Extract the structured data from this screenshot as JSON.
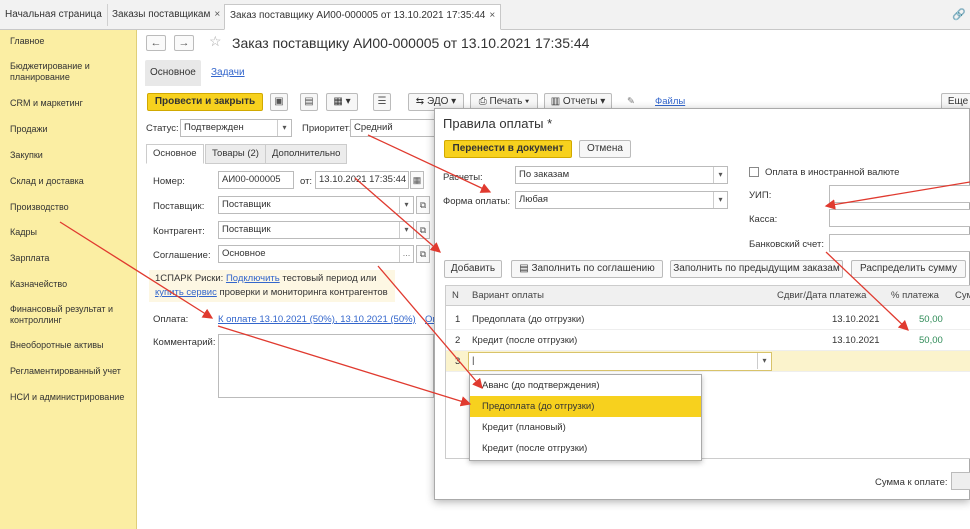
{
  "tabs": [
    {
      "label": "Начальная страница"
    },
    {
      "label": "Заказы поставщикам"
    },
    {
      "label": "Заказ поставщику АИ00-000005 от 13.10.2021 17:35:44"
    }
  ],
  "sidebar": {
    "items": [
      {
        "label": "Главное"
      },
      {
        "label": "Бюджетирование и планирование"
      },
      {
        "label": "CRM и маркетинг"
      },
      {
        "label": "Продажи"
      },
      {
        "label": "Закупки"
      },
      {
        "label": "Склад и доставка"
      },
      {
        "label": "Производство"
      },
      {
        "label": "Кадры"
      },
      {
        "label": "Зарплата"
      },
      {
        "label": "Казначейство"
      },
      {
        "label": "Финансовый результат и контроллинг"
      },
      {
        "label": "Внеоборотные активы"
      },
      {
        "label": "Регламентированный учет"
      },
      {
        "label": "НСИ и администрирование"
      }
    ]
  },
  "form": {
    "title": "Заказ поставщику АИ00-000005 от 13.10.2021 17:35:44",
    "subtab_main": "Основное",
    "subtab_tasks": "Задачи",
    "post_close_label": "Провести и закрыть",
    "edo_label": "ЭДО",
    "print_label": "Печать",
    "reports_label": "Отчеты",
    "files_label": "Файлы",
    "more_label": "Еще",
    "status_label": "Статус:",
    "status_value": "Подтвержден",
    "priority_label": "Приоритет:",
    "priority_value": "Средний",
    "inner_tabs": [
      "Основное",
      "Товары (2)",
      "Дополнительно"
    ],
    "number_label": "Номер:",
    "number_value": "АИ00-000005",
    "from_label": "от:",
    "date_value": "13.10.2021 17:35:44",
    "supplier_label": "Поставщик:",
    "supplier_value": "Поставщик",
    "counterparty_label": "Контрагент:",
    "counterparty_value": "Поставщик",
    "agreement_label": "Соглашение:",
    "agreement_value": "Основное",
    "notice_1": "1СПАРК Риски:",
    "notice_link1": "Подключить",
    "notice_2": "тестовый период или",
    "notice_link2": "купить сервис",
    "notice_3": "проверки и мониторинга контрагентов",
    "payment_label": "Оплата:",
    "payment_value": "К оплате 13.10.2021 (50%), 13.10.2021 (50%)",
    "payment_more": "Оп",
    "comment_label": "Комментарий:"
  },
  "dialog": {
    "title": "Правила оплаты *",
    "transfer_label": "Перенести в документ",
    "cancel_label": "Отмена",
    "settlements_label": "Расчеты:",
    "settlements_value": "По заказам",
    "payment_form_label": "Форма оплаты:",
    "payment_form_value": "Любая",
    "foreign_currency_label": "Оплата в иностранной валюте",
    "uip_label": "УИП:",
    "cashbox_label": "Касса:",
    "bank_account_label": "Банковский счет:",
    "add_label": "Добавить",
    "fill_agreement_label": "Заполнить по соглашению",
    "fill_prev_label": "Заполнить по предыдущим заказам",
    "distribute_label": "Распределить сумму",
    "columns": [
      "N",
      "Вариант оплаты",
      "Сдвиг/Дата платежа",
      "% платежа",
      "Сум"
    ],
    "rows": [
      {
        "n": "1",
        "variant": "Предоплата (до отгрузки)",
        "date": "13.10.2021",
        "percent": "50,00"
      },
      {
        "n": "2",
        "variant": "Кредит (после отгрузки)",
        "date": "13.10.2021",
        "percent": "50,00"
      },
      {
        "n": "3",
        "variant": "",
        "date": "",
        "percent": ""
      }
    ],
    "dropdown_options": [
      "Аванс (до подтверждения)",
      "Предоплата (до отгрузки)",
      "Кредит (плановый)",
      "Кредит (после отгрузки)"
    ],
    "selected_option_index": 1,
    "total_label": "Сумма к оплате:"
  },
  "colors": {
    "accent_yellow": "#f7d11e",
    "sidebar_bg": "#fbeea3",
    "link_blue": "#3366cc",
    "annotation_red": "#e03a2f",
    "percent_green": "#2e8b57"
  }
}
